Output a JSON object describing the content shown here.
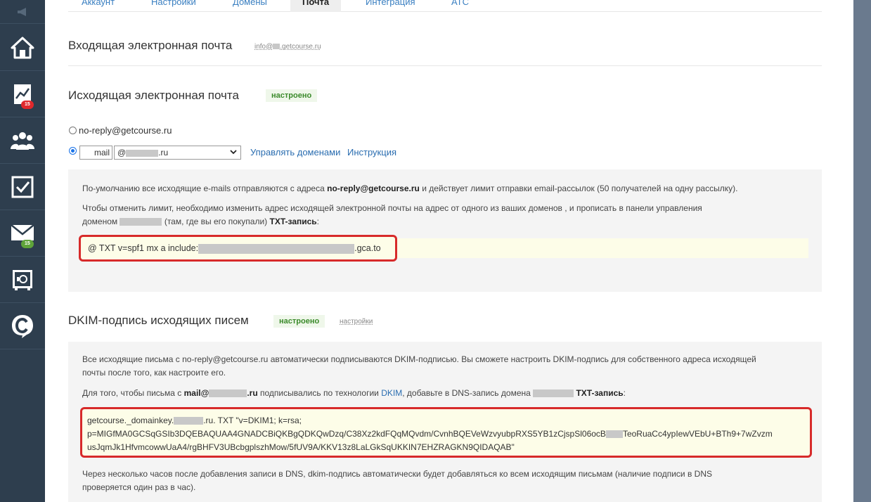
{
  "tabs": [
    {
      "label": "Аккаунт"
    },
    {
      "label": "Настройки"
    },
    {
      "label": "Домены"
    },
    {
      "label": "Почта"
    },
    {
      "label": "Интеграция"
    },
    {
      "label": "АТС"
    }
  ],
  "active_tab": "Почта",
  "sidebar": {
    "items": [
      {
        "icon": "home-icon"
      },
      {
        "icon": "chart-icon",
        "badge": "15"
      },
      {
        "icon": "users-icon"
      },
      {
        "icon": "checkbox-icon"
      },
      {
        "icon": "mail-icon",
        "badge": "15"
      },
      {
        "icon": "safe-icon"
      },
      {
        "icon": "getcourse-logo-icon"
      }
    ]
  },
  "incoming": {
    "title": "Входящая электронная почта",
    "email_prefix": "info@",
    "email_suffix": ".getcourse.ru"
  },
  "outgoing": {
    "title": "Исходящая электронная почта",
    "status": "настроено",
    "option_default": "no-reply@getcourse.ru",
    "mail_value": "mail",
    "domain_prefix": "@",
    "domain_suffix": ".ru",
    "manage_domains_link": "Управлять доменами",
    "instruction_link": "Инструкция",
    "info1_a": "По-умолчанию все исходящие e-mails отправляются с адреса ",
    "info1_b": "no-reply@getcourse.ru",
    "info1_c": " и действует лимит отправки email-рассылок (50 получателей на одну рассылку).",
    "info2_a": "Чтобы отменить лимит, необходимо изменить адрес исходящей электронной почты на адрес от одного из ваших доменов",
    "info2_b": " , и прописать в панели управления",
    "info2_c": "доменом ",
    "info2_d": " (там, где вы его покупали) ",
    "info2_e": "TXT-запись",
    "info2_f": ":",
    "spf_a": "@ TXT v=spf1 mx a include:",
    "spf_b": ".gca.to"
  },
  "dkim": {
    "title": "DKIM-подпись исходящих писем",
    "status": "настроено",
    "settings_link": "настройки",
    "info1": "Все исходящие письма с no-reply@getcourse.ru автоматически подписываются DKIM-подписью. Вы сможете настроить DKIM-подпись для собственного адреса исходящей",
    "info1b": "почты после того, как настроите его.",
    "info2_a": "Для того, чтобы письма с ",
    "info2_b": "mail@",
    "info2_c": ".ru",
    "info2_d": " подписывались по технологии ",
    "info2_link": "DKIM",
    "info2_e": ", добавьте в DNS-запись домена ",
    "info2_f": " TXT-запись",
    "info2_g": ":",
    "code_line1_a": "getcourse._domainkey.",
    "code_line1_b": ".ru. TXT \"v=DKIM1; k=rsa;",
    "code_line2_a": "p=MIGfMA0GCSqGSIb3DQEBAQUAA4GNADCBiQKBgQDKQwDzq/C38Xz2kdFQqMQvdm/CvnhBQEVeWzvyubpRXS5YB1zCjspSl06ocB",
    "code_line2_b": "TeoRuaCc4ypIewVEbU+BTh9+7wZvzm",
    "code_line3": "usJqmJk1HfvmcowwUaA4/rgBHFV3UBcbgplszhMow/5fUV9A/KKV13z8LaLGkSqUKKIN7EHZRAGKN9QIDAQAB\"",
    "footer1": "Через несколько часов после добавления записи в DNS, dkim-подпись автоматически будет добавляться ко всем исходящим письмам (наличие подписи в DNS",
    "footer2": "проверяется один раз в час)."
  },
  "colors": {
    "sidebar_bg": "#2e3e4e",
    "link": "#2a6db0",
    "status_green": "#3a8a2a",
    "highlight_red": "#d72a2a",
    "code_bg": "#fdfde8"
  }
}
